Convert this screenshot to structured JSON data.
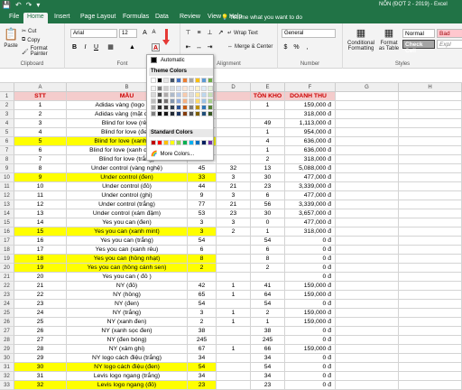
{
  "titlebar": {
    "title": "NỐN (ĐỢT 2 - 2019)  -  Excel"
  },
  "tabs": [
    "File",
    "Home",
    "Insert",
    "Page Layout",
    "Formulas",
    "Data",
    "Review",
    "View",
    "Help"
  ],
  "tell_me": "Tell me what you want to do",
  "clipboard": {
    "cut": "Cut",
    "copy": "Copy",
    "format_painter": "Format Painter",
    "paste": "Paste",
    "label": "Clipboard"
  },
  "font": {
    "name": "Arial",
    "size": "12",
    "label": "Font"
  },
  "alignment": {
    "wrap": "Wrap Text",
    "merge": "Merge & Center",
    "label": "Alignment"
  },
  "number": {
    "format": "General",
    "label": "Number"
  },
  "styles": {
    "cond": "Conditional Formatting",
    "table": "Format as Table",
    "normal": "Normal",
    "bad": "Bad",
    "check": "Check Cell",
    "expl": "Expl",
    "label": "Styles"
  },
  "color_popup": {
    "automatic": "Automatic",
    "theme": "Theme Colors",
    "standard": "Standard Colors",
    "more": "More Colors...",
    "theme_top": [
      "#ffffff",
      "#000000",
      "#e7e6e6",
      "#44546a",
      "#4472c4",
      "#ed7d31",
      "#a5a5a5",
      "#ffc000",
      "#5b9bd5",
      "#70ad47"
    ],
    "theme_tints": [
      [
        "#f2f2f2",
        "#7f7f7f",
        "#d0cece",
        "#d6dce4",
        "#d9e2f3",
        "#fbe5d6",
        "#ededed",
        "#fff2cc",
        "#deebf7",
        "#e2f0d9"
      ],
      [
        "#d9d9d9",
        "#595959",
        "#aeaaaa",
        "#adb9ca",
        "#b4c7e7",
        "#f8cbad",
        "#dbdbdb",
        "#ffe699",
        "#bdd7ee",
        "#c5e0b4"
      ],
      [
        "#bfbfbf",
        "#404040",
        "#767171",
        "#8497b0",
        "#8faadc",
        "#f4b183",
        "#c9c9c9",
        "#ffd966",
        "#9dc3e6",
        "#a9d18e"
      ],
      [
        "#a6a6a6",
        "#262626",
        "#3a3838",
        "#323f4f",
        "#2f5597",
        "#c55a11",
        "#7b7b7b",
        "#bf9000",
        "#2e75b6",
        "#548235"
      ],
      [
        "#808080",
        "#0d0d0d",
        "#171616",
        "#222a35",
        "#1f3864",
        "#843c0c",
        "#525252",
        "#7f6000",
        "#1f4e79",
        "#385723"
      ]
    ],
    "standard_colors": [
      "#c00000",
      "#ff0000",
      "#ffc000",
      "#ffff00",
      "#92d050",
      "#00b050",
      "#00b0f0",
      "#0070c0",
      "#002060",
      "#7030a0"
    ]
  },
  "columns": [
    "A",
    "B",
    "C",
    "D",
    "E",
    "F",
    "G",
    "H"
  ],
  "header": {
    "stt": "STT",
    "mau": "MẪU",
    "c": "",
    "d": "",
    "ton": "TỒN KHO",
    "dt": "DOANH THU"
  },
  "rows": [
    {
      "n": "2",
      "a": "1",
      "b": "Adidas vàng (logo đen)",
      "c": "",
      "d": "",
      "e": "1",
      "f": "159,000 đ",
      "y": false
    },
    {
      "n": "3",
      "a": "2",
      "b": "Adidas vàng (mặt cười)",
      "c": "",
      "d": "",
      "e": "",
      "f": "318,000 đ",
      "y": false
    },
    {
      "n": "4",
      "a": "3",
      "b": "Blind for love (rêu)",
      "c": "",
      "d": "",
      "e": "49",
      "f": "1,113,000 đ",
      "y": false
    },
    {
      "n": "5",
      "a": "4",
      "b": "Blind for love (đen)",
      "c": "",
      "d": "",
      "e": "1",
      "f": "954,000 đ",
      "y": false
    },
    {
      "n": "6",
      "a": "5",
      "b": "Blind for love (xanh rêu)",
      "c": "",
      "d": "",
      "e": "4",
      "f": "636,000 đ",
      "y": true
    },
    {
      "n": "7",
      "a": "6",
      "b": "Blind for love (xanh dương)",
      "c": "",
      "d": "",
      "e": "1",
      "f": "636,000 đ",
      "y": false
    },
    {
      "n": "8",
      "a": "7",
      "b": "Blind for love (trắng)",
      "c": "",
      "d": "",
      "e": "2",
      "f": "318,000 đ",
      "y": false
    },
    {
      "n": "9",
      "a": "8",
      "b": "Under control (vàng nghệ)",
      "c": "45",
      "d": "32",
      "e": "13",
      "f": "5,088,000 đ",
      "y": false
    },
    {
      "n": "10",
      "a": "9",
      "b": "Under control (đen)",
      "c": "33",
      "d": "3",
      "e": "30",
      "f": "477,000 đ",
      "y": true
    },
    {
      "n": "11",
      "a": "10",
      "b": "Under control (đỏ)",
      "c": "44",
      "d": "21",
      "e": "23",
      "f": "3,339,000 đ",
      "y": false
    },
    {
      "n": "12",
      "a": "11",
      "b": "Under control (ghi)",
      "c": "9",
      "d": "3",
      "e": "6",
      "f": "477,000 đ",
      "y": false
    },
    {
      "n": "13",
      "a": "12",
      "b": "Under control (trắng)",
      "c": "77",
      "d": "21",
      "e": "56",
      "f": "3,339,000 đ",
      "y": false
    },
    {
      "n": "14",
      "a": "13",
      "b": "Under control (xám đậm)",
      "c": "53",
      "d": "23",
      "e": "30",
      "f": "3,657,000 đ",
      "y": false
    },
    {
      "n": "15",
      "a": "14",
      "b": "Yes you can (đen)",
      "c": "3",
      "d": "3",
      "e": "0",
      "f": "477,000 đ",
      "y": false
    },
    {
      "n": "16",
      "a": "15",
      "b": "Yes you can (xanh mint)",
      "c": "3",
      "d": "2",
      "e": "1",
      "f": "318,000 đ",
      "y": true
    },
    {
      "n": "17",
      "a": "16",
      "b": "Yes you can (trắng)",
      "c": "54",
      "d": "",
      "e": "54",
      "f": "0 đ",
      "y": false
    },
    {
      "n": "18",
      "a": "17",
      "b": "Yes you can (xanh rêu)",
      "c": "6",
      "d": "",
      "e": "6",
      "f": "0 đ",
      "y": false
    },
    {
      "n": "19",
      "a": "18",
      "b": "Yes you can (hồng nhạt)",
      "c": "8",
      "d": "",
      "e": "8",
      "f": "0 đ",
      "y": true
    },
    {
      "n": "20",
      "a": "19",
      "b": "Yes you can (hồng cánh sen)",
      "c": "2",
      "d": "",
      "e": "2",
      "f": "0 đ",
      "y": true
    },
    {
      "n": "21",
      "a": "20",
      "b": "Yes you can ( đỏ )",
      "c": "",
      "d": "",
      "e": "",
      "f": "0 đ",
      "y": false
    },
    {
      "n": "22",
      "a": "21",
      "b": "NY (đỏ)",
      "c": "42",
      "d": "1",
      "e": "41",
      "f": "159,000 đ",
      "y": false
    },
    {
      "n": "23",
      "a": "22",
      "b": "NY (hồng)",
      "c": "65",
      "d": "1",
      "e": "64",
      "f": "159,000 đ",
      "y": false
    },
    {
      "n": "24",
      "a": "23",
      "b": "NY (đen)",
      "c": "54",
      "d": "",
      "e": "54",
      "f": "0 đ",
      "y": false
    },
    {
      "n": "25",
      "a": "24",
      "b": "NY (trắng)",
      "c": "3",
      "d": "1",
      "e": "2",
      "f": "159,000 đ",
      "y": false
    },
    {
      "n": "26",
      "a": "25",
      "b": "NY (xanh đen)",
      "c": "2",
      "d": "1",
      "e": "1",
      "f": "159,000 đ",
      "y": false
    },
    {
      "n": "27",
      "a": "26",
      "b": "NY (xanh sọc đen)",
      "c": "38",
      "d": "",
      "e": "38",
      "f": "0 đ",
      "y": false
    },
    {
      "n": "28",
      "a": "27",
      "b": "NY (đen bóng)",
      "c": "245",
      "d": "",
      "e": "245",
      "f": "0 đ",
      "y": false
    },
    {
      "n": "29",
      "a": "28",
      "b": "NY (xám ghi)",
      "c": "67",
      "d": "1",
      "e": "66",
      "f": "159,000 đ",
      "y": false
    },
    {
      "n": "30",
      "a": "29",
      "b": "NY logo cách điệu (trắng)",
      "c": "34",
      "d": "",
      "e": "34",
      "f": "0 đ",
      "y": false
    },
    {
      "n": "31",
      "a": "30",
      "b": "NY logo cách điệu (đen)",
      "c": "54",
      "d": "",
      "e": "54",
      "f": "0 đ",
      "y": true
    },
    {
      "n": "32",
      "a": "31",
      "b": "Levis logo ngang (trắng)",
      "c": "34",
      "d": "",
      "e": "34",
      "f": "0 đ",
      "y": false
    },
    {
      "n": "33",
      "a": "32",
      "b": "Levis logo ngang (đỏ)",
      "c": "23",
      "d": "",
      "e": "23",
      "f": "0 đ",
      "y": true
    }
  ]
}
